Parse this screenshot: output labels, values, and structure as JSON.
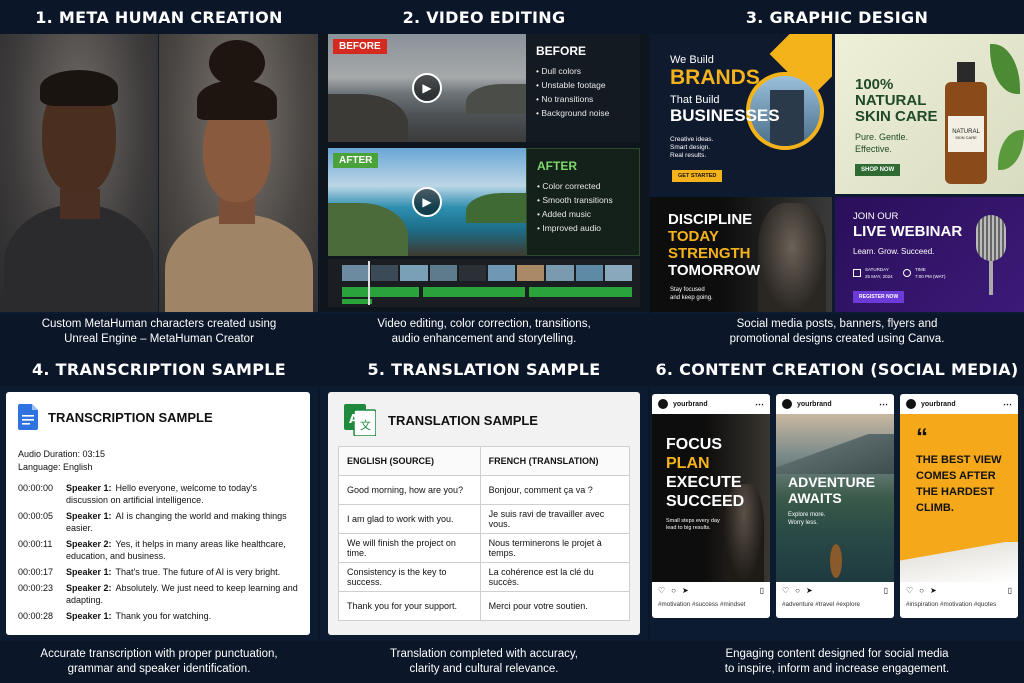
{
  "panels": {
    "meta_human": {
      "title": "1. META HUMAN CREATION",
      "caption_line1": "Custom MetaHuman characters created using",
      "caption_line2": "Unreal Engine – MetaHuman Creator"
    },
    "video_editing": {
      "title": "2. VIDEO EDITING",
      "before_tag": "BEFORE",
      "before_heading": "BEFORE",
      "before_items": [
        "Dull colors",
        "Unstable footage",
        "No transitions",
        "Background noise"
      ],
      "after_tag": "AFTER",
      "after_heading": "AFTER",
      "after_items": [
        "Color corrected",
        "Smooth transitions",
        "Added music",
        "Improved audio"
      ],
      "caption_line1": "Video editing, color correction, transitions,",
      "caption_line2": "audio enhancement and storytelling."
    },
    "graphic_design": {
      "title": "3. GRAPHIC DESIGN",
      "brands": {
        "line1": "We Build",
        "line2": "BRANDS",
        "line3": "That Build",
        "line4": "BUSINESSES",
        "sub1": "Creative ideas.",
        "sub2": "Smart design.",
        "sub3": "Real results.",
        "cta": "GET STARTED"
      },
      "skincare": {
        "line1": "100%",
        "line2": "NATURAL",
        "line3": "SKIN CARE",
        "sub1": "Pure. Gentle.",
        "sub2": "Effective.",
        "cta": "SHOP NOW",
        "bottle_label1": "NATURAL",
        "bottle_label2": "SKIN CARE"
      },
      "discipline": {
        "line1": "DISCIPLINE",
        "line2": "TODAY",
        "line3": "STRENGTH",
        "line4": "TOMORROW",
        "sub1": "Stay focused",
        "sub2": "and keep going."
      },
      "webinar": {
        "line1": "JOIN OUR",
        "line2": "LIVE WEBINAR",
        "sub": "Learn. Grow. Succeed.",
        "day_label": "SATURDAY",
        "date": "25 MAY, 2024",
        "time_label": "TIME",
        "time": "7:00 PM (WAT)",
        "cta": "REGISTER NOW"
      },
      "caption_line1": "Social media posts, banners, flyers and",
      "caption_line2": "promotional designs created using Canva."
    },
    "transcription": {
      "title": "4. TRANSCRIPTION SAMPLE",
      "card_title": "TRANSCRIPTION SAMPLE",
      "audio_duration": "Audio Duration:  03:15",
      "language": "Language: English",
      "rows": [
        {
          "time": "00:00:00",
          "speaker": "Speaker 1:",
          "text": "Hello everyone, welcome to today's discussion on artificial intelligence."
        },
        {
          "time": "00:00:05",
          "speaker": "Speaker 1:",
          "text": "AI is changing the world and making things easier."
        },
        {
          "time": "00:00:11",
          "speaker": "Speaker 2:",
          "text": "Yes, it helps in many areas like healthcare, education, and business."
        },
        {
          "time": "00:00:17",
          "speaker": "Speaker 1:",
          "text": "That's true. The future of AI is very bright."
        },
        {
          "time": "00:00:23",
          "speaker": "Speaker 2:",
          "text": "Absolutely. We just need to keep learning and adapting."
        },
        {
          "time": "00:00:28",
          "speaker": "Speaker 1:",
          "text": "Thank you for watching."
        }
      ],
      "caption_line1": "Accurate transcription with proper punctuation,",
      "caption_line2": "grammar and speaker identification."
    },
    "translation": {
      "title": "5. TRANSLATION SAMPLE",
      "card_title": "TRANSLATION SAMPLE",
      "col_source": "ENGLISH (SOURCE)",
      "col_target": "FRENCH (TRANSLATION)",
      "rows": [
        {
          "en": "Good morning, how are you?",
          "fr": "Bonjour, comment ça va ?"
        },
        {
          "en": "I am glad to work with you.",
          "fr": "Je suis ravi de travailler avec vous."
        },
        {
          "en": "We will finish the project on time.",
          "fr": "Nous terminerons le projet à temps."
        },
        {
          "en": "Consistency is the key to success.",
          "fr": "La cohérence est la clé du succès."
        },
        {
          "en": "Thank you for your support.",
          "fr": "Merci pour votre soutien."
        }
      ],
      "caption_line1": "Translation completed with accuracy,",
      "caption_line2": "clarity and cultural relevance."
    },
    "content_creation": {
      "title": "6. CONTENT CREATION (SOCIAL MEDIA)",
      "posts": [
        {
          "handle": "yourbrand",
          "l1": "FOCUS",
          "l2": "PLAN",
          "l3": "EXECUTE",
          "l4": "SUCCEED",
          "sub1": "Small steps every day",
          "sub2": "lead to big results.",
          "tags": "#motivation #success #mindset"
        },
        {
          "handle": "yourbrand",
          "l1": "ADVENTURE",
          "l2": "AWAITS",
          "sub1": "Explore more.",
          "sub2": "Worry less.",
          "tags": "#adventure #travel #explore"
        },
        {
          "handle": "yourbrand",
          "quote": "“",
          "l1": "THE BEST VIEW",
          "l2": "COMES AFTER",
          "l3": "THE HARDEST",
          "l4": "CLIMB.",
          "tags": "#inspiration #motivation #quotes"
        }
      ],
      "caption_line1": "Engaging content designed for social media",
      "caption_line2": "to inspire, inform and increase engagement."
    }
  }
}
